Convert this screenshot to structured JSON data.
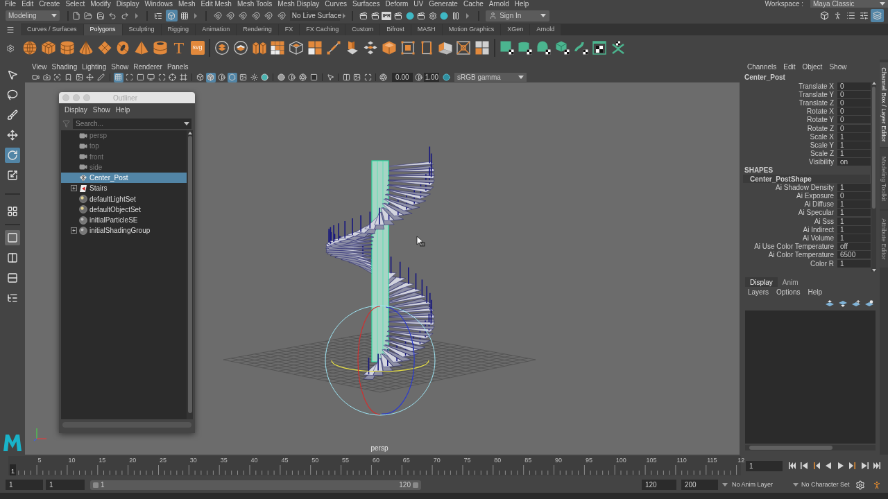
{
  "menu_bar": {
    "items": [
      "File",
      "Edit",
      "Create",
      "Select",
      "Modify",
      "Display",
      "Windows",
      "Mesh",
      "Edit Mesh",
      "Mesh Tools",
      "Mesh Display",
      "Curves",
      "Surfaces",
      "Deform",
      "UV",
      "Generate",
      "Cache",
      "Arnold",
      "Help"
    ],
    "workspace_label": "Workspace :",
    "workspace": "Maya Classic"
  },
  "status_line": {
    "menu_set": "Modeling",
    "selection_modes": [
      {
        "kind": "hierarchy",
        "selected": false
      },
      {
        "kind": "object",
        "selected": true
      },
      {
        "kind": "component",
        "selected": false
      }
    ],
    "live_surface": "No Live Surface",
    "ipr_label": "IPR",
    "sign_in": "Sign In",
    "panel_toggles": [
      {
        "kind": "modeling-toolkit",
        "selected": false
      },
      {
        "kind": "character-controls",
        "selected": false
      },
      {
        "kind": "attribute-editor",
        "selected": false
      },
      {
        "kind": "tool-settings",
        "selected": false
      },
      {
        "kind": "channel-box",
        "selected": true
      }
    ]
  },
  "shelf": {
    "tabs": [
      {
        "label": "Curves / Surfaces",
        "selected": false
      },
      {
        "label": "Polygons",
        "selected": true
      },
      {
        "label": "Sculpting",
        "selected": false
      },
      {
        "label": "Rigging",
        "selected": false
      },
      {
        "label": "Animation",
        "selected": false
      },
      {
        "label": "Rendering",
        "selected": false
      },
      {
        "label": "FX",
        "selected": false
      },
      {
        "label": "FX Caching",
        "selected": false
      },
      {
        "label": "Custom",
        "selected": false
      },
      {
        "label": "Bifrost",
        "selected": false
      },
      {
        "label": "MASH",
        "selected": false
      },
      {
        "label": "Motion Graphics",
        "selected": false
      },
      {
        "label": "XGen",
        "selected": false
      },
      {
        "label": "Arnold",
        "selected": false
      }
    ],
    "type_tool": "T",
    "svg_tool": "svg"
  },
  "toolbox": {
    "tools": [
      {
        "kind": "select",
        "selected": false
      },
      {
        "kind": "lasso",
        "selected": false
      },
      {
        "kind": "paint",
        "selected": false
      },
      {
        "kind": "move",
        "selected": false
      },
      {
        "kind": "rotate",
        "selected": true
      },
      {
        "kind": "scale",
        "selected": false
      }
    ],
    "layouts": [
      {
        "kind": "four",
        "selected": false
      },
      {
        "kind": "single",
        "selected": true
      },
      {
        "kind": "columns",
        "selected": false
      },
      {
        "kind": "rows",
        "selected": false
      },
      {
        "kind": "outliner",
        "selected": false
      }
    ]
  },
  "viewport": {
    "menus": [
      "View",
      "Shading",
      "Lighting",
      "Show",
      "Renderer",
      "Panels"
    ],
    "view_toggles": [
      {
        "kind": "grid",
        "selected": true
      },
      {
        "kind": "film-gate",
        "selected": false
      },
      {
        "kind": "resolution-gate",
        "selected": false
      },
      {
        "kind": "gate-mask",
        "selected": false
      },
      {
        "kind": "field-chart",
        "selected": false
      },
      {
        "kind": "safe-action",
        "selected": false
      },
      {
        "kind": "safe-title",
        "selected": false
      }
    ],
    "shading_toggles": [
      {
        "kind": "wireframe",
        "selected": false
      },
      {
        "kind": "smooth",
        "selected": true
      },
      {
        "kind": "default-material",
        "selected": false
      },
      {
        "kind": "wireframe-on-shaded",
        "selected": true
      },
      {
        "kind": "textured",
        "selected": false
      },
      {
        "kind": "lights",
        "selected": false
      },
      {
        "kind": "shadows",
        "selected": false
      }
    ],
    "exposure": "0.00",
    "gamma": "1.00",
    "color_space": "sRGB gamma",
    "camera": "persp"
  },
  "outliner": {
    "title": "Outliner",
    "menus": [
      "Display",
      "Show",
      "Help"
    ],
    "search": {
      "placeholder": "Search..."
    },
    "items": [
      {
        "label": "persp",
        "kind": "camera",
        "hidden": true,
        "collapsed": false,
        "selected": false
      },
      {
        "label": "top",
        "kind": "camera",
        "hidden": true,
        "collapsed": false,
        "selected": false
      },
      {
        "label": "front",
        "kind": "camera",
        "hidden": true,
        "collapsed": false,
        "selected": false
      },
      {
        "label": "side",
        "kind": "camera",
        "hidden": true,
        "collapsed": false,
        "selected": false
      },
      {
        "label": "Center_Post",
        "kind": "mesh",
        "hidden": false,
        "collapsed": false,
        "selected": true
      },
      {
        "label": "Stairs",
        "kind": "group",
        "hidden": false,
        "collapsed": true,
        "selected": false
      },
      {
        "label": "defaultLightSet",
        "kind": "set",
        "hidden": false,
        "collapsed": false,
        "selected": false
      },
      {
        "label": "defaultObjectSet",
        "kind": "set",
        "hidden": false,
        "collapsed": false,
        "selected": false
      },
      {
        "label": "initialParticleSE",
        "kind": "shading",
        "hidden": false,
        "collapsed": false,
        "selected": false
      },
      {
        "label": "initialShadingGroup",
        "kind": "shading",
        "hidden": false,
        "collapsed": true,
        "selected": false
      }
    ]
  },
  "channel_box": {
    "menus": [
      "Channels",
      "Edit",
      "Object",
      "Show"
    ],
    "object": "Center_Post",
    "attributes": [
      {
        "name": "Translate X",
        "value": "0"
      },
      {
        "name": "Translate Y",
        "value": "0"
      },
      {
        "name": "Translate Z",
        "value": "0"
      },
      {
        "name": "Rotate X",
        "value": "0"
      },
      {
        "name": "Rotate Y",
        "value": "0"
      },
      {
        "name": "Rotate Z",
        "value": "0"
      },
      {
        "name": "Scale X",
        "value": "1"
      },
      {
        "name": "Scale Y",
        "value": "1"
      },
      {
        "name": "Scale Z",
        "value": "1"
      },
      {
        "name": "Visibility",
        "value": "on"
      }
    ],
    "shapes_heading": "SHAPES",
    "shape": "Center_PostShape",
    "shape_attributes": [
      {
        "name": "Ai Shadow Density",
        "value": "1"
      },
      {
        "name": "Ai Exposure",
        "value": "0"
      },
      {
        "name": "Ai Diffuse",
        "value": "1"
      },
      {
        "name": "Ai Specular",
        "value": "1"
      },
      {
        "name": "Ai Sss",
        "value": "1"
      },
      {
        "name": "Ai Indirect",
        "value": "1"
      },
      {
        "name": "Ai Volume",
        "value": "1"
      },
      {
        "name": "Ai Use Color Temperature",
        "value": "off"
      },
      {
        "name": "Ai Color Temperature",
        "value": "6500"
      },
      {
        "name": "Color R",
        "value": "1"
      }
    ]
  },
  "side_tabs": [
    {
      "label": "Channel Box / Layer Editor",
      "selected": true
    },
    {
      "label": "Modeling Toolkit",
      "selected": false
    },
    {
      "label": "Attribute Editor",
      "selected": false
    }
  ],
  "layer_editor": {
    "tabs": [
      {
        "label": "Display",
        "selected": true
      },
      {
        "label": "Anim",
        "selected": false
      }
    ],
    "menus": [
      "Layers",
      "Options",
      "Help"
    ]
  },
  "time_slider": {
    "ticks": [
      "5",
      "10",
      "15",
      "20",
      "25",
      "30",
      "35",
      "40",
      "45",
      "50",
      "55",
      "60",
      "65",
      "70",
      "75",
      "80",
      "85",
      "90",
      "95",
      "100",
      "105",
      "110",
      "115",
      "12"
    ],
    "current_frame_marker": "1",
    "level": 0,
    "current_frame": "1"
  },
  "range_slider": {
    "start": "1",
    "playback_start": "1",
    "range_start": "1",
    "range_end": "120",
    "level": 0.6,
    "playback_end": "120",
    "end": "200",
    "anim_layer": "No Anim Layer",
    "character_set": "No Character Set"
  }
}
